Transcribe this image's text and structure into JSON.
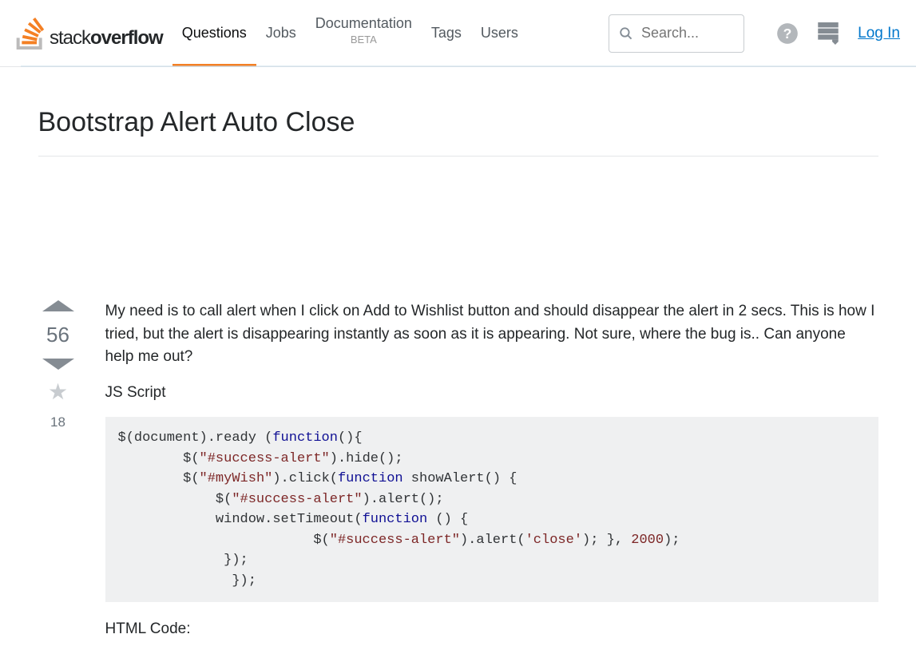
{
  "brand": {
    "a": "stack",
    "b": "overflow"
  },
  "nav": {
    "questions": "Questions",
    "jobs": "Jobs",
    "docs": "Documentation",
    "beta": "BETA",
    "tags": "Tags",
    "users": "Users"
  },
  "search": {
    "placeholder": "Search..."
  },
  "login": "Log In",
  "question": {
    "title": "Bootstrap Alert Auto Close",
    "votes": "56",
    "favorites": "18",
    "body_p1": "My need is to call alert when I click on Add to Wishlist button and should disappear the alert in 2 secs. This is how I tried, but the alert is disappearing instantly as soon as it is appearing. Not sure, where the bug is.. Can anyone help me out?",
    "heading_js": "JS Script",
    "heading_html": "HTML Code:",
    "code": {
      "l1a": "$(document).ready (",
      "l1b": "function",
      "l1c": "(){",
      "l2a": "        $(",
      "l2b": "\"#success-alert\"",
      "l2c": ").hide();",
      "l3a": "        $(",
      "l3b": "\"#myWish\"",
      "l3c": ").click(",
      "l3d": "function",
      "l3e": " showAlert() {",
      "l4a": "            $(",
      "l4b": "\"#success-alert\"",
      "l4c": ").alert();",
      "l5a": "            window.setTimeout(",
      "l5b": "function",
      "l5c": " () {",
      "l6a": "                        $(",
      "l6b": "\"#success-alert\"",
      "l6c": ").alert(",
      "l6d": "'close'",
      "l6e": "); }, ",
      "l6f": "2000",
      "l6g": ");",
      "l7": "             });",
      "l8": "              });"
    }
  }
}
